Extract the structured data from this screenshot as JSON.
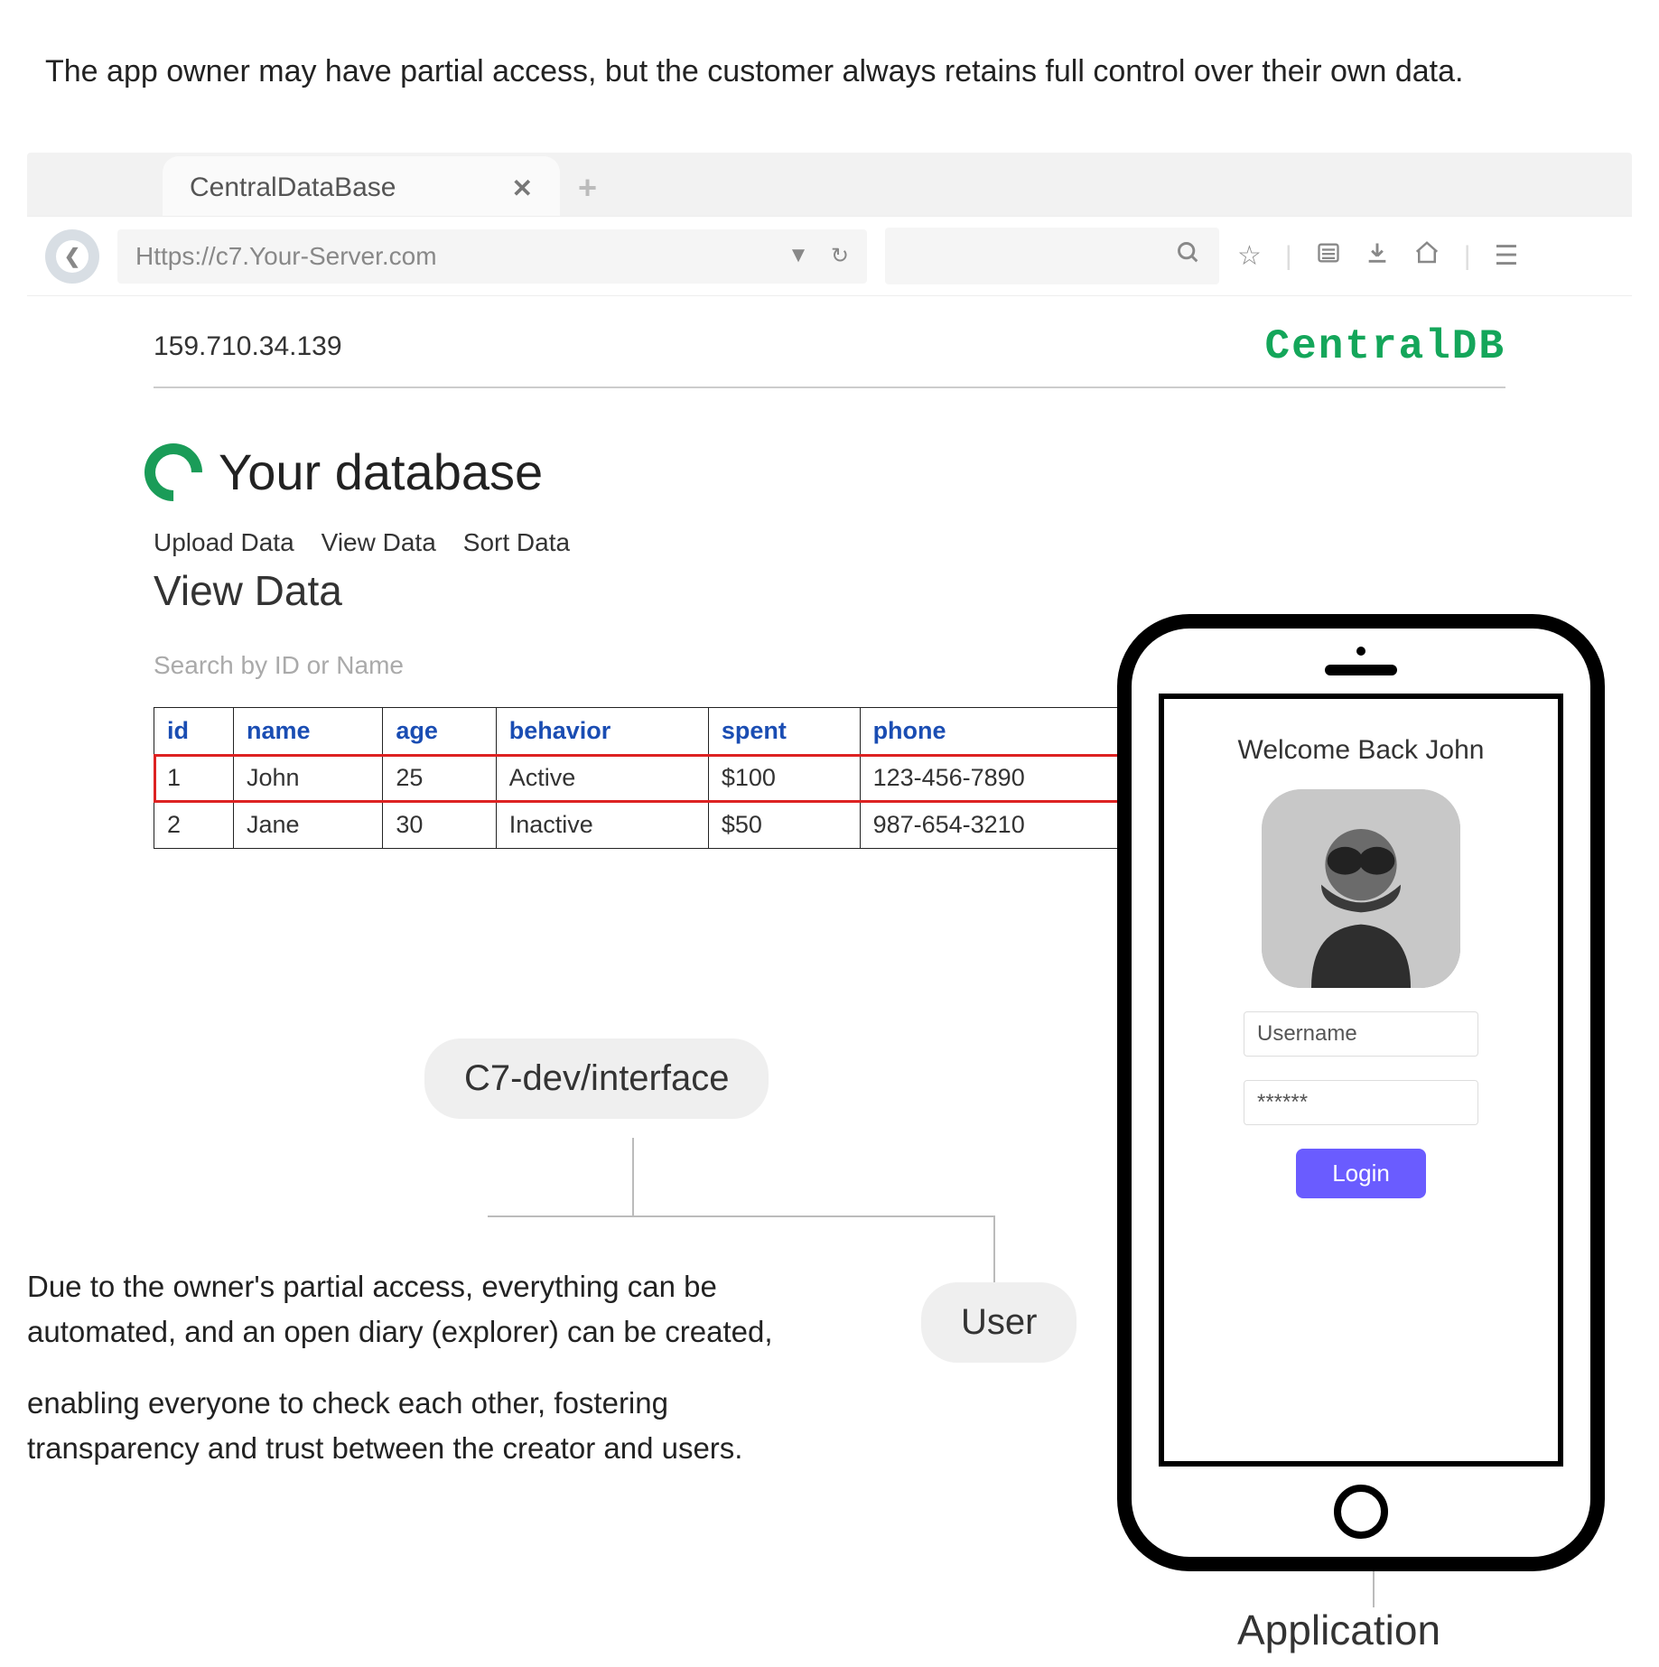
{
  "top_caption": "The app owner may have partial access, but the customer always retains full control over their own data.",
  "browser": {
    "tab_title": "CentralDataBase",
    "url": "Https://c7.Your-Server.com"
  },
  "page": {
    "ip": "159.710.34.139",
    "brand": "CentralDB",
    "db_title": "Your database",
    "nav": [
      "Upload Data",
      "View Data",
      "Sort Data"
    ],
    "section": "View Data",
    "search_placeholder": "Search by ID or Name",
    "columns": [
      "id",
      "name",
      "age",
      "behavior",
      "spent",
      "phone"
    ],
    "rows": [
      {
        "id": "1",
        "name": "John",
        "age": "25",
        "behavior": "Active",
        "spent": "$100",
        "phone": "123-456-7890",
        "highlight": true
      },
      {
        "id": "2",
        "name": "Jane",
        "age": "30",
        "behavior": "Inactive",
        "spent": "$50",
        "phone": "987-654-3210",
        "highlight": false
      }
    ]
  },
  "labels": {
    "interface": "C7-dev/interface",
    "user": "User",
    "application": "Application"
  },
  "phone": {
    "welcome": "Welcome Back John",
    "username_placeholder": "Username",
    "password_value": "******",
    "login": "Login"
  },
  "bottom_text": {
    "p1": "Due to the owner's partial access, everything can be automated, and an open diary (explorer) can be created,",
    "p2": "enabling everyone to check each other, fostering transparency and trust between the creator and users."
  }
}
